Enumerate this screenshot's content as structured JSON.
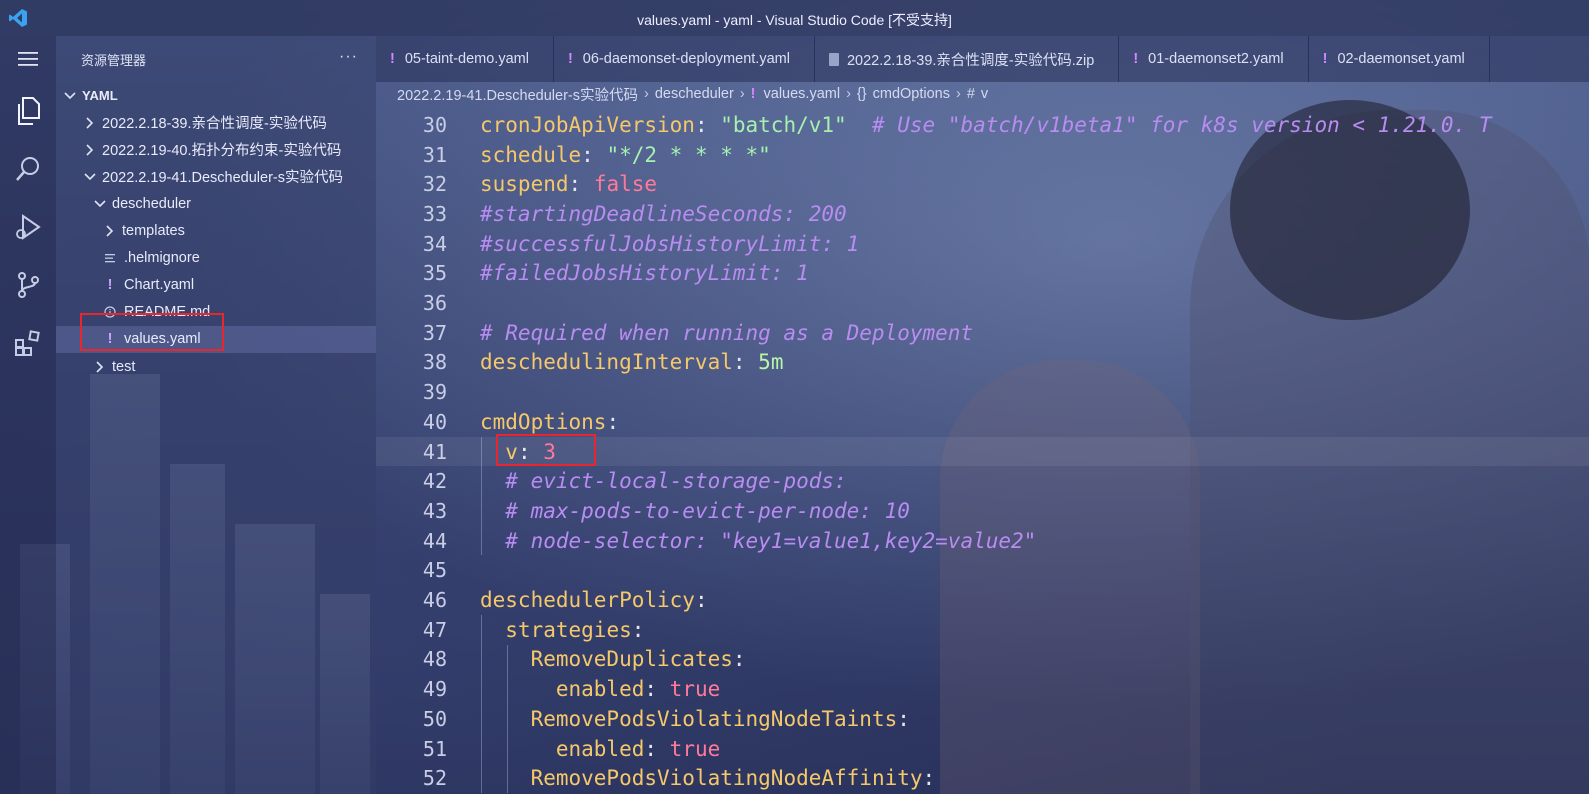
{
  "window": {
    "title": "values.yaml - yaml - Visual Studio Code [不受支持]"
  },
  "activity_bar": {
    "items": [
      "menu-icon",
      "explorer-icon",
      "search-icon",
      "run-debug-icon",
      "source-control-icon",
      "extensions-icon"
    ]
  },
  "sidebar": {
    "header": "资源管理器",
    "more": "···",
    "tree": [
      {
        "label": "YAML",
        "level": 0,
        "kind": "root",
        "chevron": "open"
      },
      {
        "label": "2022.2.18-39.亲合性调度-实验代码",
        "level": 1,
        "kind": "folder",
        "chevron": "closed"
      },
      {
        "label": "2022.2.19-40.拓扑分布约束-实验代码",
        "level": 1,
        "kind": "folder",
        "chevron": "closed"
      },
      {
        "label": "2022.2.19-41.Descheduler-s实验代码",
        "level": 1,
        "kind": "folder",
        "chevron": "open"
      },
      {
        "label": "descheduler",
        "level": 2,
        "kind": "folder",
        "chevron": "open"
      },
      {
        "label": "templates",
        "level": 3,
        "kind": "folder",
        "chevron": "closed"
      },
      {
        "label": ".helmignore",
        "level": 3,
        "kind": "file-lines"
      },
      {
        "label": "Chart.yaml",
        "level": 3,
        "kind": "file-yaml"
      },
      {
        "label": "README.md",
        "level": 3,
        "kind": "file-info"
      },
      {
        "label": "values.yaml",
        "level": 3,
        "kind": "file-yaml",
        "selected": true
      },
      {
        "label": "test",
        "level": 2,
        "kind": "folder",
        "chevron": "closed"
      }
    ]
  },
  "tabs": [
    {
      "label": "05-taint-demo.yaml",
      "kind": "yaml"
    },
    {
      "label": "06-daemonset-deployment.yaml",
      "kind": "yaml"
    },
    {
      "label": "2022.2.18-39.亲合性调度-实验代码.zip",
      "kind": "zip"
    },
    {
      "label": "01-daemonset2.yaml",
      "kind": "yaml"
    },
    {
      "label": "02-daemonset.yaml",
      "kind": "yaml"
    }
  ],
  "breadcrumb": {
    "folder": "2022.2.19-41.Descheduler-s实验代码",
    "subfolder": "descheduler",
    "file": "values.yaml",
    "object": "cmdOptions",
    "key": "v",
    "object_symbol": "{}",
    "key_symbol": "#"
  },
  "editor": {
    "current_line": 41,
    "lines": [
      {
        "n": "30",
        "tokens": [
          [
            "k",
            "cronJobApiVersion"
          ],
          [
            "p",
            ": "
          ],
          [
            "s",
            "\"batch/v1\""
          ],
          [
            "p",
            "  "
          ],
          [
            "c",
            "# Use \"batch/v1beta1\" for k8s version < 1.21.0. T"
          ]
        ]
      },
      {
        "n": "31",
        "tokens": [
          [
            "k",
            "schedule"
          ],
          [
            "p",
            ": "
          ],
          [
            "s",
            "\"*/2 * * * *\""
          ]
        ]
      },
      {
        "n": "32",
        "tokens": [
          [
            "k",
            "suspend"
          ],
          [
            "p",
            ": "
          ],
          [
            "b",
            "false"
          ]
        ]
      },
      {
        "n": "33",
        "tokens": [
          [
            "c",
            "#startingDeadlineSeconds: 200"
          ]
        ]
      },
      {
        "n": "34",
        "tokens": [
          [
            "c",
            "#successfulJobsHistoryLimit: 1"
          ]
        ]
      },
      {
        "n": "35",
        "tokens": [
          [
            "c",
            "#failedJobsHistoryLimit: 1"
          ]
        ]
      },
      {
        "n": "36",
        "tokens": []
      },
      {
        "n": "37",
        "tokens": [
          [
            "c",
            "# Required when running as a Deployment"
          ]
        ]
      },
      {
        "n": "38",
        "tokens": [
          [
            "k",
            "deschedulingInterval"
          ],
          [
            "p",
            ": "
          ],
          [
            "m",
            "5m"
          ]
        ]
      },
      {
        "n": "39",
        "tokens": []
      },
      {
        "n": "40",
        "tokens": [
          [
            "k",
            "cmdOptions"
          ],
          [
            "p",
            ":"
          ]
        ]
      },
      {
        "n": "41",
        "tokens": [
          [
            "p",
            "  "
          ],
          [
            "k",
            "v"
          ],
          [
            "p",
            ": "
          ],
          [
            "n",
            "3"
          ]
        ]
      },
      {
        "n": "42",
        "tokens": [
          [
            "p",
            "  "
          ],
          [
            "c",
            "# evict-local-storage-pods:"
          ]
        ]
      },
      {
        "n": "43",
        "tokens": [
          [
            "p",
            "  "
          ],
          [
            "c",
            "# max-pods-to-evict-per-node: 10"
          ]
        ]
      },
      {
        "n": "44",
        "tokens": [
          [
            "p",
            "  "
          ],
          [
            "c",
            "# node-selector: \"key1=value1,key2=value2\""
          ]
        ]
      },
      {
        "n": "45",
        "tokens": []
      },
      {
        "n": "46",
        "tokens": [
          [
            "k",
            "deschedulerPolicy"
          ],
          [
            "p",
            ":"
          ]
        ]
      },
      {
        "n": "47",
        "tokens": [
          [
            "p",
            "  "
          ],
          [
            "k",
            "strategies"
          ],
          [
            "p",
            ":"
          ]
        ]
      },
      {
        "n": "48",
        "tokens": [
          [
            "p",
            "    "
          ],
          [
            "k",
            "RemoveDuplicates"
          ],
          [
            "p",
            ":"
          ]
        ]
      },
      {
        "n": "49",
        "tokens": [
          [
            "p",
            "      "
          ],
          [
            "k",
            "enabled"
          ],
          [
            "p",
            ": "
          ],
          [
            "b",
            "true"
          ]
        ]
      },
      {
        "n": "50",
        "tokens": [
          [
            "p",
            "    "
          ],
          [
            "k",
            "RemovePodsViolatingNodeTaints"
          ],
          [
            "p",
            ":"
          ]
        ]
      },
      {
        "n": "51",
        "tokens": [
          [
            "p",
            "      "
          ],
          [
            "k",
            "enabled"
          ],
          [
            "p",
            ": "
          ],
          [
            "b",
            "true"
          ]
        ]
      },
      {
        "n": "52",
        "tokens": [
          [
            "p",
            "    "
          ],
          [
            "k",
            "RemovePodsViolatingNodeAffinity"
          ],
          [
            "p",
            ":"
          ]
        ]
      }
    ]
  },
  "colors": {
    "key": "#f5c86a",
    "string": "#a6f0b0",
    "boolean": "#ff7a9a",
    "comment": "#b98cf2",
    "highlight_box": "#e8262e"
  }
}
